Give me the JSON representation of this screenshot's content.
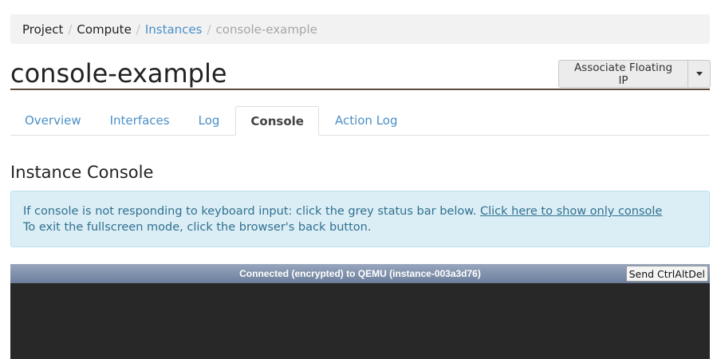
{
  "breadcrumb": {
    "items": [
      {
        "label": "Project"
      },
      {
        "label": "Compute"
      },
      {
        "label": "Instances"
      },
      {
        "label": "console-example"
      }
    ],
    "separator": "/"
  },
  "header": {
    "title": "console-example",
    "action_label": "Associate Floating IP"
  },
  "tabs": [
    {
      "label": "Overview"
    },
    {
      "label": "Interfaces"
    },
    {
      "label": "Log"
    },
    {
      "label": "Console"
    },
    {
      "label": "Action Log"
    }
  ],
  "active_tab": "Console",
  "console_section": {
    "title": "Instance Console",
    "info_line1": "If console is not responding to keyboard input: click the grey status bar below.",
    "info_link": "Click here to show only console",
    "info_line2": "To exit the fullscreen mode, click the browser's back button."
  },
  "console": {
    "status": "Connected (encrypted) to QEMU (instance-003a3d76)",
    "send_cad_label": "Send CtrlAltDel"
  },
  "colors": {
    "link": "#4a8fc7",
    "info_bg": "#dbeef6",
    "info_text": "#31708f",
    "console_bg": "#282828"
  }
}
